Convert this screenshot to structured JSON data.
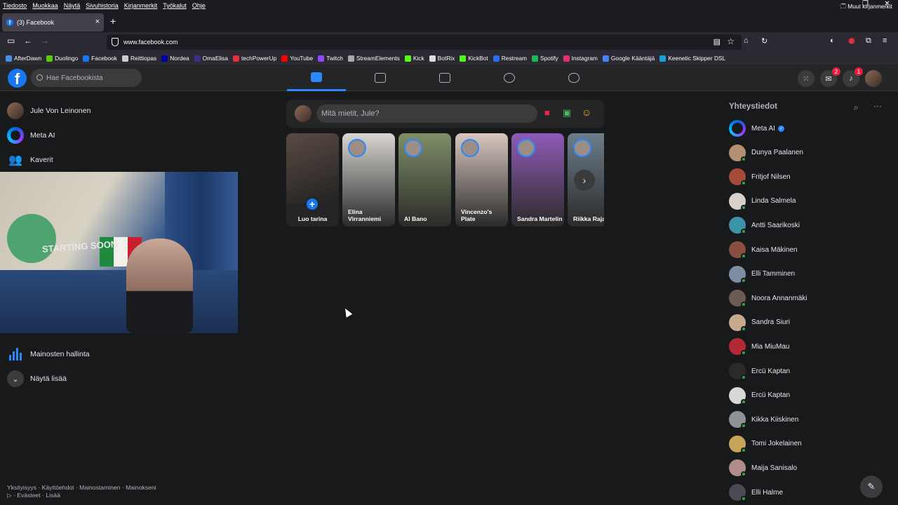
{
  "menubar": [
    "Tiedosto",
    "Muokkaa",
    "Näytä",
    "Sivuhistoria",
    "Kirjanmerkit",
    "Työkalut",
    "Ohje"
  ],
  "window_controls": [
    "–",
    "❐",
    "✕"
  ],
  "tab": {
    "title": "(3) Facebook",
    "close": "×",
    "new": "+"
  },
  "url": "www.facebook.com",
  "bookmarks": [
    {
      "label": "AfterDawn",
      "color": "#4a90e2"
    },
    {
      "label": "Duolingo",
      "color": "#58cc02"
    },
    {
      "label": "Facebook",
      "color": "#1877f2"
    },
    {
      "label": "Reittiopas",
      "color": "#cccccc"
    },
    {
      "label": "Nordea",
      "color": "#0000a0"
    },
    {
      "label": "OmaElisa",
      "color": "#3a2f8a"
    },
    {
      "label": "techPowerUp",
      "color": "#e0303c"
    },
    {
      "label": "YouTube",
      "color": "#ff0000"
    },
    {
      "label": "Twitch",
      "color": "#9146ff"
    },
    {
      "label": "StreamElements",
      "color": "#aaaaaa"
    },
    {
      "label": "Kick",
      "color": "#53fc18"
    },
    {
      "label": "BotRix",
      "color": "#dddddd"
    },
    {
      "label": "KickBot",
      "color": "#53fc18"
    },
    {
      "label": "Restream",
      "color": "#2b6de8"
    },
    {
      "label": "Spotify",
      "color": "#1db954"
    },
    {
      "label": "Instagram",
      "color": "#e1306c"
    },
    {
      "label": "Google Kääntäjä",
      "color": "#4285f4"
    },
    {
      "label": "Keenetic Skipper DSL",
      "color": "#1aa0db"
    }
  ],
  "bookmarks_other": "Muut kirjanmerkit",
  "fb": {
    "logo": "f",
    "search_placeholder": "Hae Facebookista",
    "messenger_badge": "2",
    "notifications_badge": "1"
  },
  "sidebar": {
    "items": [
      {
        "label": "Jule Von Leinonen"
      },
      {
        "label": "Meta AI"
      },
      {
        "label": "Kaverit"
      }
    ],
    "ads": "Mainosten hallinta",
    "more": "Näytä lisää",
    "footer_line1": "Yksityisyys · Käyttöehdot · Mainostaminen · Mainokseni",
    "footer_line2": "▷ · Evästeet · Lisää"
  },
  "webcam_overlay_text": "STARTING SOON",
  "composer": {
    "placeholder": "Mitä mietit, Jule?"
  },
  "stories": {
    "create_label": "Luo tarina",
    "items": [
      {
        "name": "Elina Virranniemi",
        "bg": "#d9d6d2"
      },
      {
        "name": "Al Bano",
        "bg": "#7f8f66"
      },
      {
        "name": "Vincenzo's Plate",
        "bg": "#d8c7bf"
      },
      {
        "name": "Sandra Martelin",
        "bg": "#8f5bb8"
      },
      {
        "name": "Riikka Rajavuori",
        "bg": "#6c7d8a"
      }
    ]
  },
  "contacts": {
    "title": "Yhteystiedot",
    "items": [
      {
        "name": "Meta AI",
        "verified": true
      },
      {
        "name": "Dunya Paalanen",
        "color": "#b58f72"
      },
      {
        "name": "Fritjof Nilsen",
        "color": "#a84a3a"
      },
      {
        "name": "Linda Salmela",
        "color": "#d9d1c9"
      },
      {
        "name": "Antti Saarikoski",
        "color": "#3a93a8"
      },
      {
        "name": "Kaisa Mäkinen",
        "color": "#8a4e3f"
      },
      {
        "name": "Elli Tamminen",
        "color": "#7d8ea3"
      },
      {
        "name": "Noora Annanmäki",
        "color": "#6e5a55"
      },
      {
        "name": "Sandra Siuri",
        "color": "#c9a98e"
      },
      {
        "name": "Mia MiuMau",
        "color": "#b22a33"
      },
      {
        "name": "Ercü Kaptan",
        "color": "#2a2a2a"
      },
      {
        "name": "Ercü Kaptan",
        "color": "#d8d8d8"
      },
      {
        "name": "Kikka Kiiskinen",
        "color": "#8c9296"
      },
      {
        "name": "Tomi Jokelainen",
        "color": "#c8a35a"
      },
      {
        "name": "Maija Sanisalo",
        "color": "#b08c8c"
      },
      {
        "name": "Elli Halme",
        "color": "#4a4a55"
      }
    ]
  }
}
